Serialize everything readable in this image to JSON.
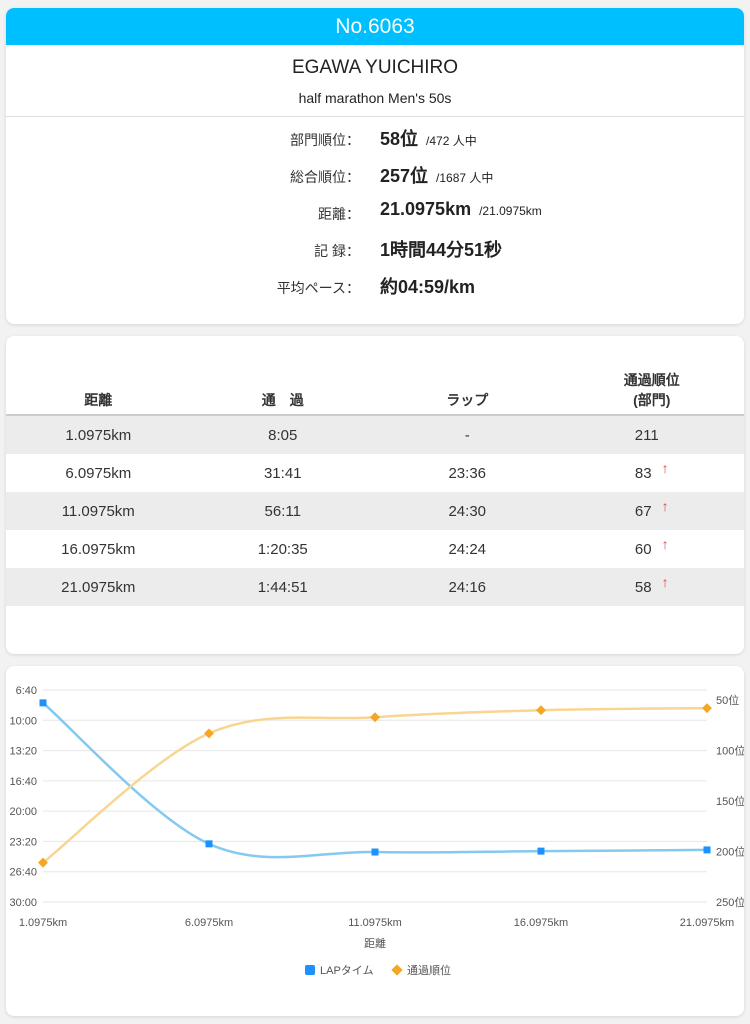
{
  "profile": {
    "bib": "No.6063",
    "name": "EGAWA YUICHIRO",
    "category": "half marathon Men's 50s",
    "stats": [
      {
        "label": "部門順位：",
        "value": "58位",
        "sub": "/472 人中"
      },
      {
        "label": "総合順位：",
        "value": "257位",
        "sub": "/1687 人中"
      },
      {
        "label": "距離：",
        "value": "21.0975km",
        "sub": "/21.0975km"
      },
      {
        "label": "記 録：",
        "value": "1時間44分51秒",
        "sub": ""
      },
      {
        "label": "平均ペース：",
        "value": "約04:59/km",
        "sub": ""
      }
    ]
  },
  "splits": {
    "headers": [
      "距離",
      "通　過",
      "ラップ",
      "通過順位",
      "(部門)"
    ],
    "rows": [
      {
        "distance": "1.0975km",
        "passage": "8:05",
        "lap": "-",
        "rank": "211",
        "trend": ""
      },
      {
        "distance": "6.0975km",
        "passage": "31:41",
        "lap": "23:36",
        "rank": "83",
        "trend": "↑"
      },
      {
        "distance": "11.0975km",
        "passage": "56:11",
        "lap": "24:30",
        "rank": "67",
        "trend": "↑"
      },
      {
        "distance": "16.0975km",
        "passage": "1:20:35",
        "lap": "24:24",
        "rank": "60",
        "trend": "↑"
      },
      {
        "distance": "21.0975km",
        "passage": "1:44:51",
        "lap": "24:16",
        "rank": "58",
        "trend": "↑"
      }
    ]
  },
  "chart_data": {
    "type": "line",
    "categories": [
      "1.0975km",
      "6.0975km",
      "11.0975km",
      "16.0975km",
      "21.0975km"
    ],
    "xlabel": "距離",
    "y_left_ticks": [
      "6:40",
      "10:00",
      "13:20",
      "16:40",
      "20:00",
      "23:20",
      "26:40",
      "30:00"
    ],
    "y_left_range_seconds": [
      400,
      1800
    ],
    "y_right_ticks": [
      "50位",
      "100位",
      "150位",
      "200位",
      "250位"
    ],
    "y_right_range": [
      40,
      250
    ],
    "series": [
      {
        "name": "LAPタイム",
        "axis": "left",
        "color": "#84c9f0",
        "marker_color": "#1e90ff",
        "marker": "square",
        "values": [
          485,
          1416,
          1470,
          1464,
          1456
        ]
      },
      {
        "name": "通過順位",
        "axis": "right",
        "color": "#f9d592",
        "marker_color": "#f5a623",
        "marker": "diamond",
        "values": [
          211,
          83,
          67,
          60,
          58
        ]
      }
    ],
    "legend_position": "bottom",
    "grid": true
  }
}
